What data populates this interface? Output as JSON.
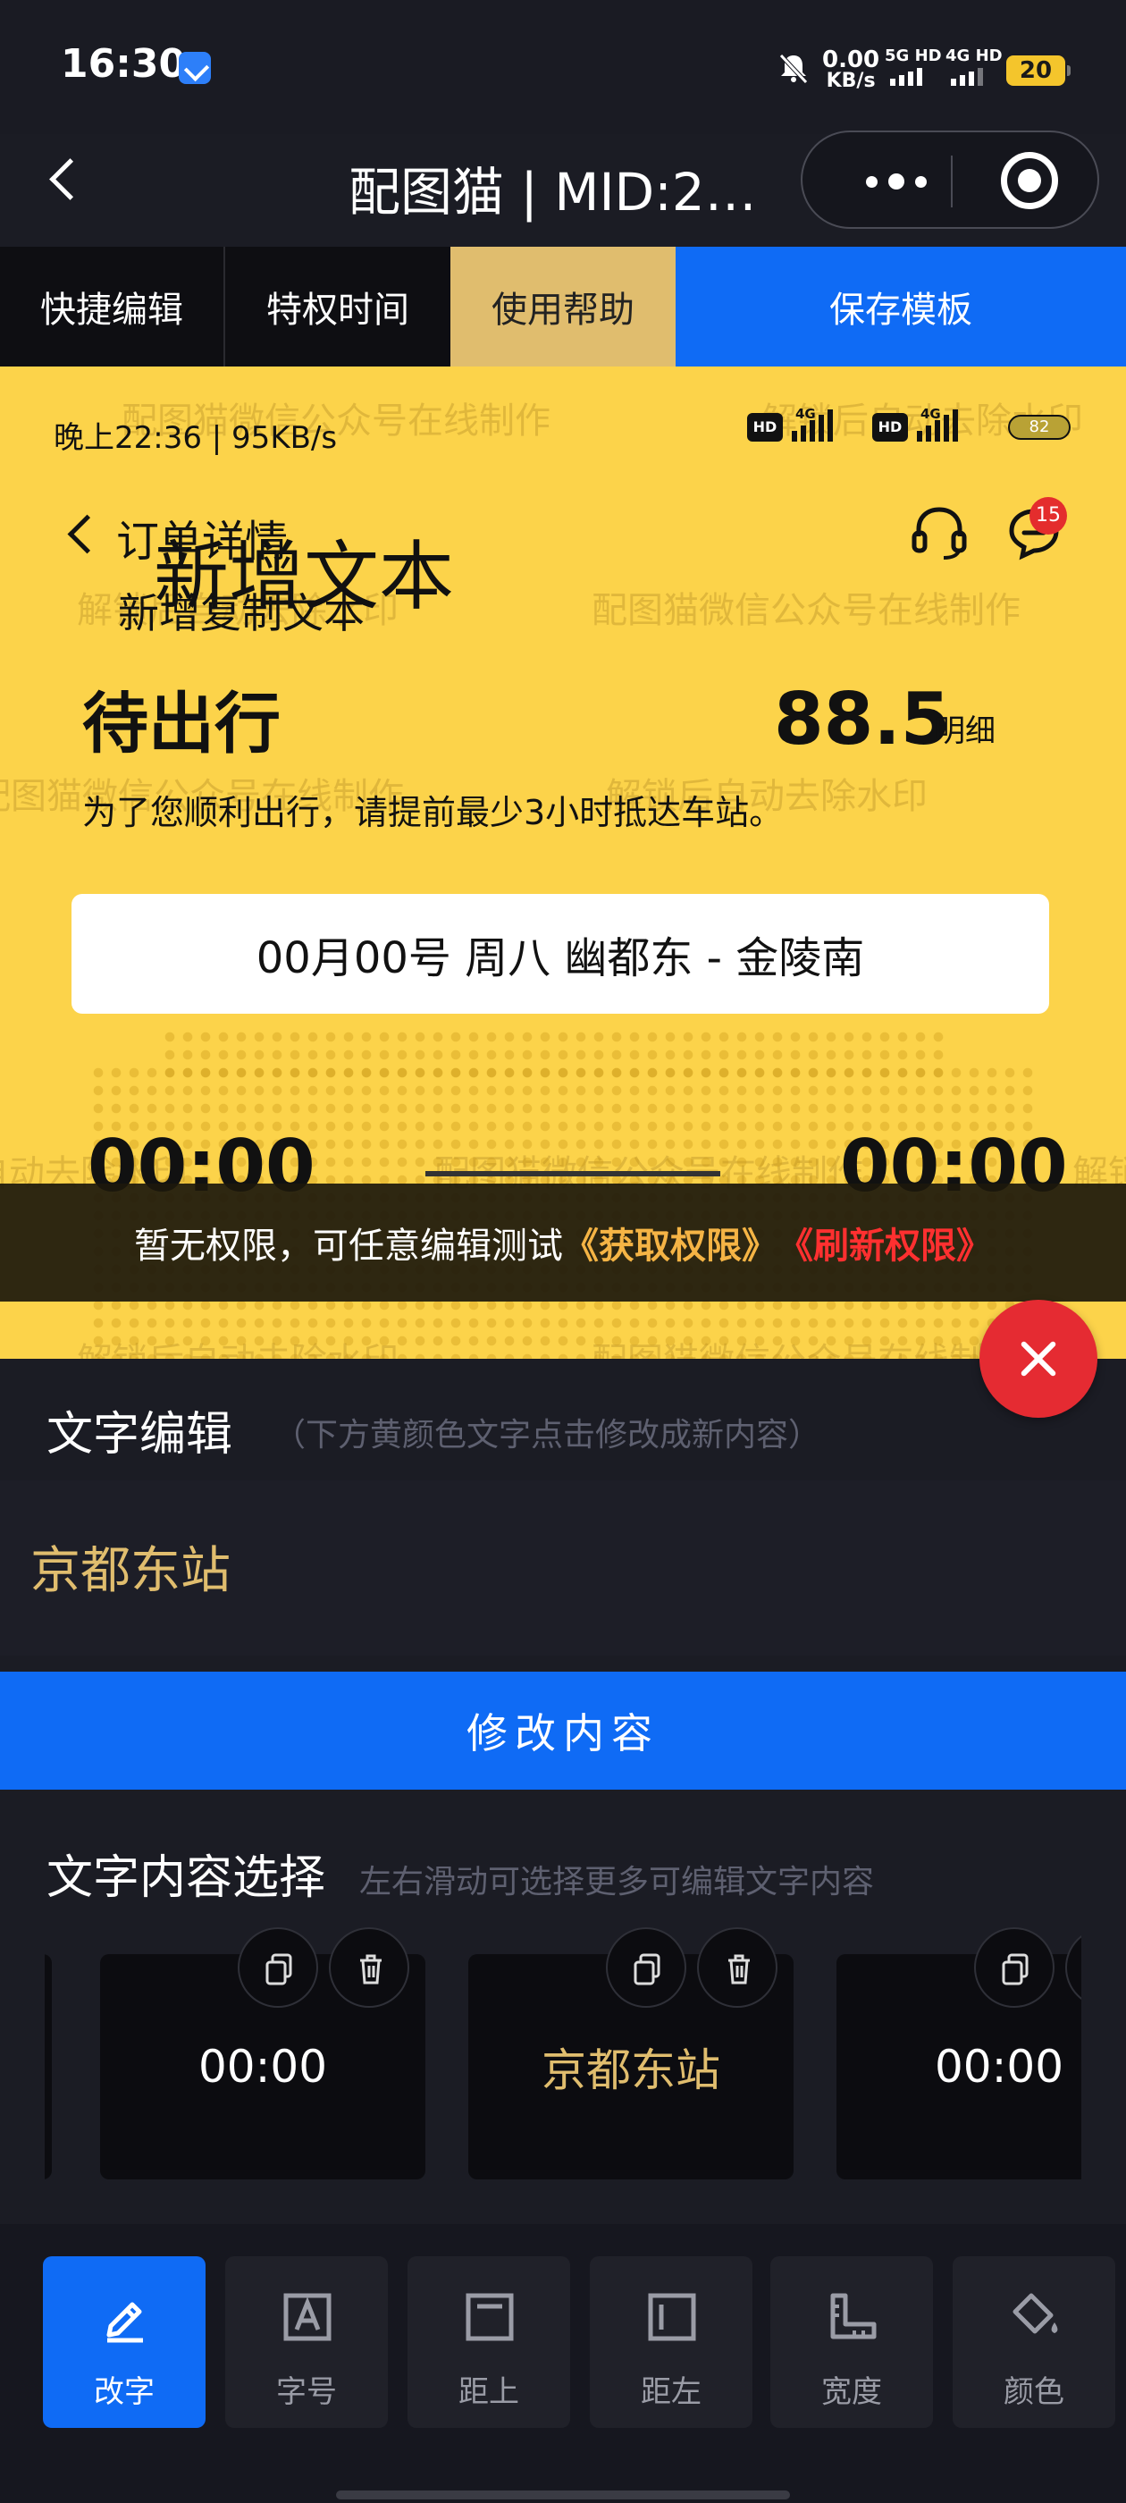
{
  "status_bar": {
    "time": "16:30",
    "net_speed_value": "0.00",
    "net_speed_unit": "KB/s",
    "sim1": "5G HD",
    "sim2": "4G HD",
    "battery": "20"
  },
  "nav": {
    "title": "配图猫 | MID:2…"
  },
  "tabs": [
    "快捷编辑",
    "特权时间",
    "使用帮助",
    "保存模板"
  ],
  "preview": {
    "phone_status": "晚上22:36 | 95KB/s",
    "hd_label": "HD",
    "net_label": "4G",
    "phone_battery": "82",
    "order_title": "订单详情",
    "added_text_large": "新增文本",
    "added_text_small": "新增复制文本",
    "chat_badge": "15",
    "status": "待出行",
    "price": "88.5",
    "price_detail": "明细",
    "tip": "为了您顺利出行，请提前最少3小时抵达车站。",
    "route": "00月00号 周八 幽都东 - 金陵南",
    "depart_time": "00:00",
    "arrive_time": "00:00",
    "watermarks": [
      "配图猫微信公众号在线制作",
      "解锁后自动去除水印"
    ]
  },
  "permission_banner": {
    "text": "暂无权限，可任意编辑测试",
    "get_link": "《获取权限》",
    "refresh_link": "《刷新权限》"
  },
  "editor": {
    "title": "文字编辑",
    "hint": "（下方黄颜色文字点击修改成新内容）",
    "value": "京都东站",
    "modify_button": "修改内容"
  },
  "selector": {
    "title": "文字内容选择",
    "hint": "左右滑动可选择更多可编辑文字内容",
    "cards": [
      {
        "text": "00:00"
      },
      {
        "text": "京都东站"
      },
      {
        "text": "00:00"
      }
    ]
  },
  "toolbar": [
    {
      "label": "改字",
      "icon": "edit-icon"
    },
    {
      "label": "字号",
      "icon": "font-size-icon"
    },
    {
      "label": "距上",
      "icon": "margin-top-icon"
    },
    {
      "label": "距左",
      "icon": "margin-left-icon"
    },
    {
      "label": "宽度",
      "icon": "width-ruler-icon"
    },
    {
      "label": "颜色",
      "icon": "paint-bucket-icon"
    }
  ],
  "colors": {
    "accent_blue": "#0f6bf5",
    "gold": "#e0bd6e",
    "preview_yellow": "#fcd34a",
    "danger_red": "#e52b32"
  }
}
